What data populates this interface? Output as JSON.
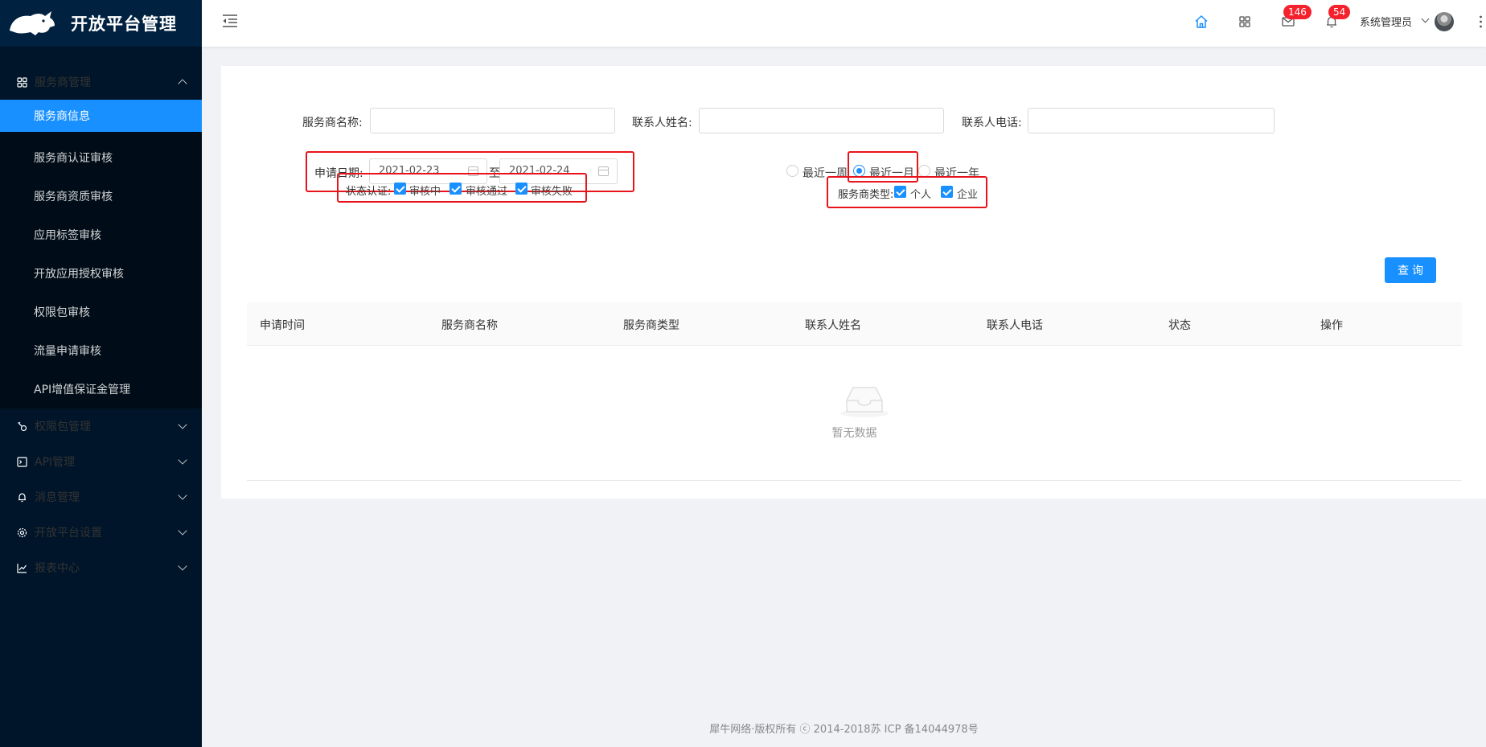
{
  "app": {
    "title": "开放平台管理"
  },
  "sidebar": {
    "groups": [
      {
        "label": "服务商管理",
        "icon": "shop-icon",
        "expanded": true,
        "items": [
          {
            "label": "服务商信息",
            "active": true
          },
          {
            "label": "服务商认证审核"
          },
          {
            "label": "服务商资质审核"
          },
          {
            "label": "应用标签审核"
          },
          {
            "label": "开放应用授权审核"
          },
          {
            "label": "权限包审核"
          },
          {
            "label": "流量申请审核"
          },
          {
            "label": "API增值保证金管理"
          }
        ]
      },
      {
        "label": "权限包管理",
        "icon": "key-icon"
      },
      {
        "label": "API管理",
        "icon": "api-icon"
      },
      {
        "label": "消息管理",
        "icon": "bell-icon"
      },
      {
        "label": "开放平台设置",
        "icon": "gear-icon"
      },
      {
        "label": "报表中心",
        "icon": "chart-line-icon"
      }
    ]
  },
  "header": {
    "mail_count": "146",
    "notice_count": "54",
    "username": "系统管理员"
  },
  "form": {
    "provider_name_label": "服务商名称:",
    "contact_name_label": "联系人姓名:",
    "contact_phone_label": "联系人电话:",
    "apply_date_label": "申请日期:",
    "date_start": "2021-02-23",
    "date_sep": "至",
    "date_end": "2021-02-24",
    "quick_ranges": [
      "最近一周",
      "最近一月",
      "最近一年"
    ],
    "quick_selected": "最近一月",
    "status_label": "状态认证:",
    "status_options": [
      "审核中",
      "审核通过",
      "审核失败"
    ],
    "type_label": "服务商类型:",
    "type_options": [
      "个人",
      "企业"
    ],
    "query_button": "查询"
  },
  "colors": {
    "accent": "#1890ff",
    "sidebar_bg": "#001529",
    "highlight": "#e8141b"
  },
  "table": {
    "columns": [
      "申请时间",
      "服务商名称",
      "服务商类型",
      "联系人姓名",
      "联系人电话",
      "状态",
      "操作"
    ],
    "empty_text": "暂无数据"
  },
  "footer": {
    "text": "犀牛网络·版权所有 ⓒ 2014-2018苏 ICP 备14044978号"
  }
}
